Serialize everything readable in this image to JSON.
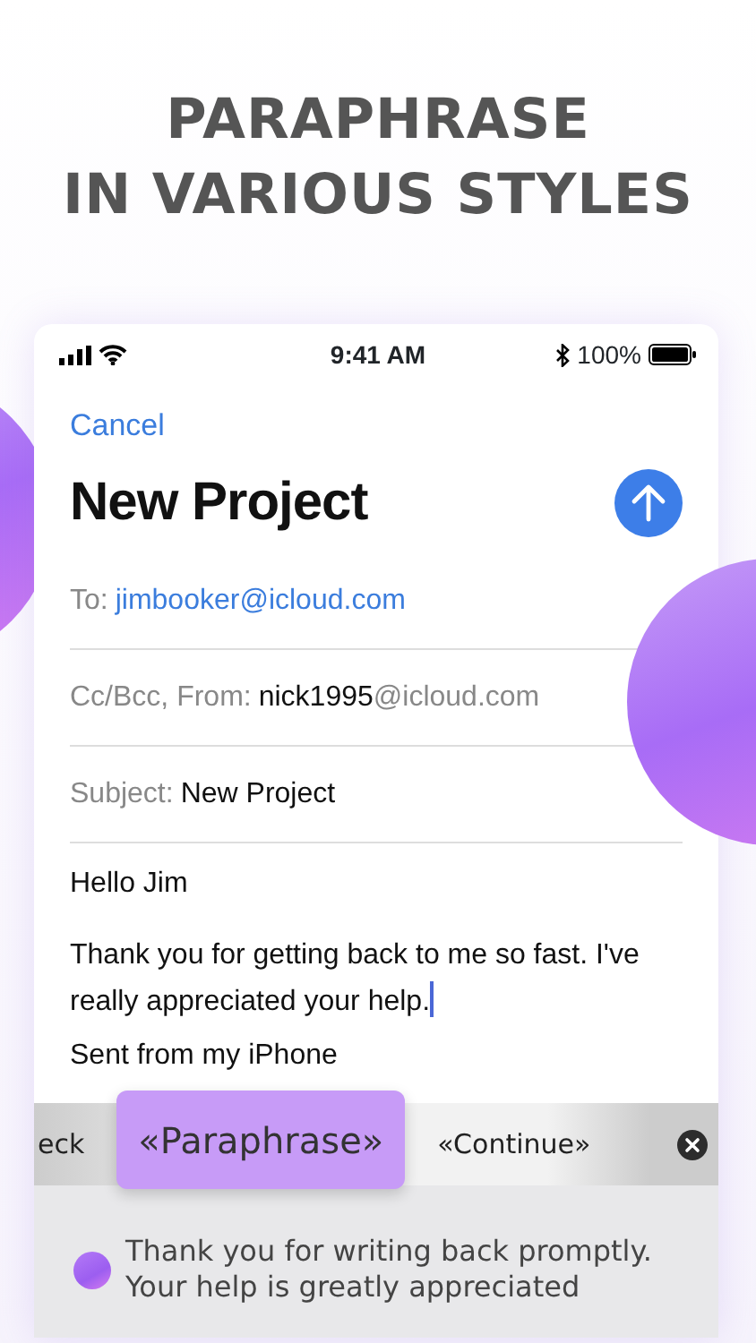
{
  "headline": [
    "PARAPHRASE",
    "IN VARIOUS STYLES"
  ],
  "status_bar": {
    "time": "9:41 AM",
    "battery": "100%"
  },
  "cancel": "Cancel",
  "title": "New Project",
  "fields": [
    {
      "kind": "link",
      "label": "To:",
      "value": "jimbooker@icloud.com"
    },
    {
      "kind": "plain",
      "label": "Cc/Bcc, From:",
      "value": "nick1995",
      "suffix": "@icloud.com"
    },
    {
      "kind": "plain",
      "label": "Subject:",
      "value": "New Project"
    }
  ],
  "body": [
    "Hello Jim",
    "Thank you for getting back to me so fast. I've really appreciated your help."
  ],
  "signature": "Sent from my iPhone",
  "suggestions": [
    {
      "label": "eck",
      "selected": false
    },
    {
      "label": "«Paraphrase»",
      "selected": true
    },
    {
      "label": "«Continue»",
      "selected": false
    }
  ],
  "result": {
    "lines": [
      "Thank you for writing back promptly.",
      "Your help is greatly appreciated"
    ]
  }
}
